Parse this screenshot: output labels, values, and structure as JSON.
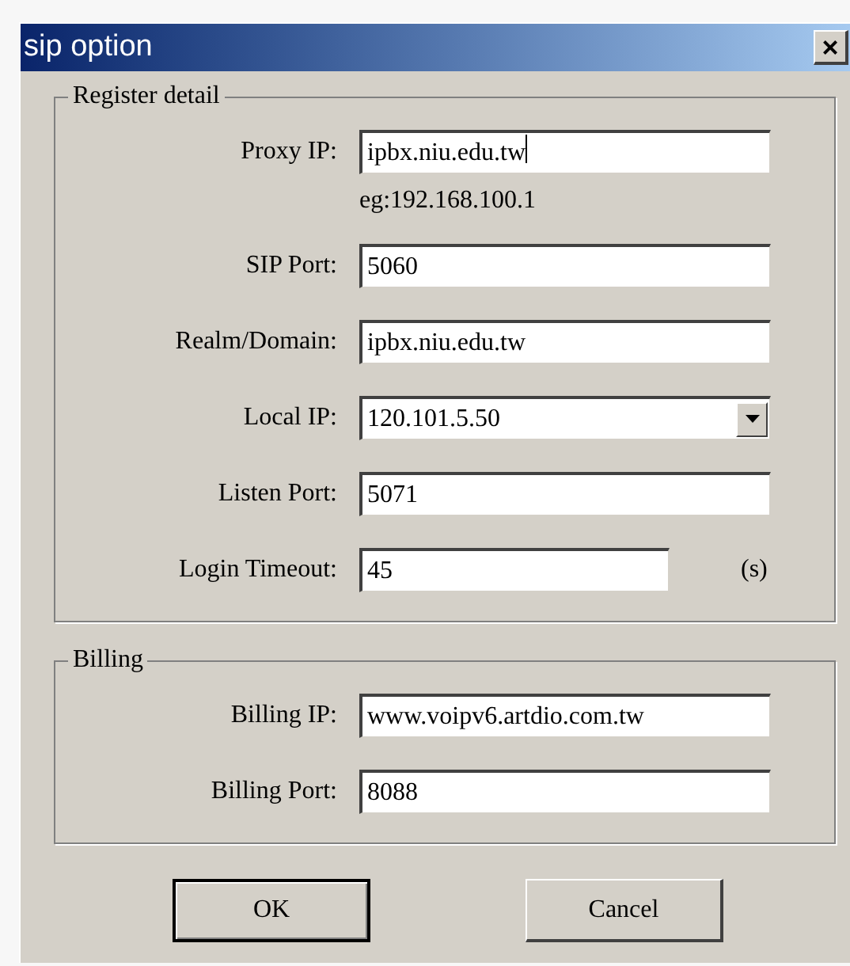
{
  "window": {
    "title": "sip option",
    "close": "×"
  },
  "groups": [
    {
      "title": "Register detail",
      "rows": [
        {
          "kind": "text",
          "label": "Proxy IP:",
          "value": "ipbx.niu.edu.tw",
          "focused": true,
          "hint": "eg:192.168.100.1"
        },
        {
          "kind": "text",
          "label": "SIP Port:",
          "value": "5060",
          "focused": false
        },
        {
          "kind": "text",
          "label": "Realm/Domain:",
          "value": "ipbx.niu.edu.tw",
          "focused": false
        },
        {
          "kind": "dropdown",
          "label": "Local IP:",
          "value": "120.101.5.50",
          "focused": false
        },
        {
          "kind": "text",
          "label": "Listen Port:",
          "value": "5071",
          "focused": false
        },
        {
          "kind": "text",
          "label": "Login Timeout:",
          "value": "45",
          "focused": false,
          "unit": "(s)"
        }
      ]
    },
    {
      "title": "Billing",
      "rows": [
        {
          "kind": "text",
          "label": "Billing IP:",
          "value": "www.voipv6.artdio.com.tw",
          "focused": false
        },
        {
          "kind": "text",
          "label": "Billing Port:",
          "value": "8088",
          "focused": false
        }
      ]
    }
  ],
  "buttons": [
    {
      "label": "OK",
      "default": true
    },
    {
      "label": "Cancel",
      "default": false
    }
  ]
}
